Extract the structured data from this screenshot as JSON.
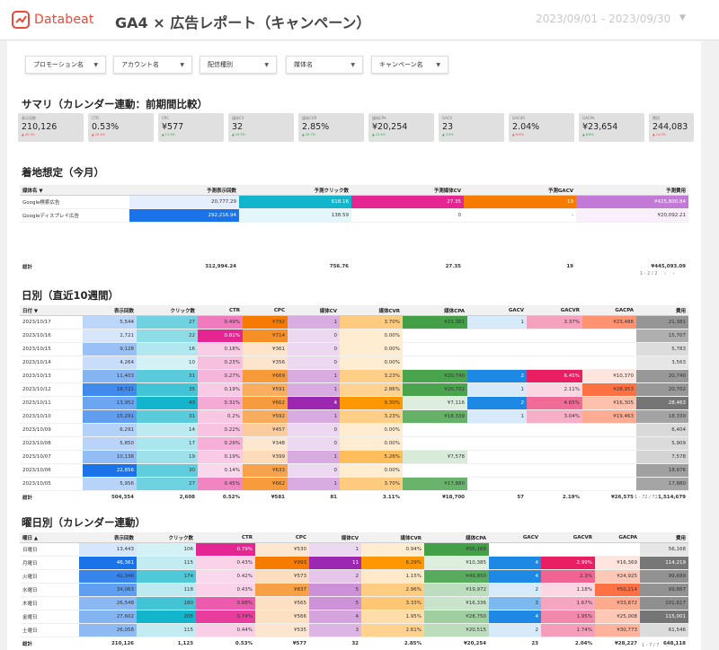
{
  "header": {
    "brand": "Databeat",
    "title": "GA4 × 広告レポート（キャンペーン）",
    "date_range": "2023/09/01 - 2023/09/30"
  },
  "filters": [
    "プロモーション名",
    "アカウント名",
    "配信種別",
    "媒体名",
    "キャンペーン名"
  ],
  "sections": {
    "summary": "サマリ（カレンダー連動：前期間比較）",
    "landing": "着地想定（今月）",
    "daily": "日別（直近10週間）",
    "weekday": "曜日別（カレンダー連動）"
  },
  "kpis": [
    {
      "label": "表示回数",
      "value": "210,126",
      "change": "▲ 42.3%",
      "up": false
    },
    {
      "label": "CTR",
      "value": "0.53%",
      "change": "▲ 20.4%",
      "up": false
    },
    {
      "label": "CPC",
      "value": "¥577",
      "change": "▲ 11.9%",
      "up": true
    },
    {
      "label": "媒体CV",
      "value": "32",
      "change": "▲ 10.3%",
      "up": true
    },
    {
      "label": "媒体CVR",
      "value": "2.85%",
      "change": "▲ 20.7%",
      "up": true
    },
    {
      "label": "媒体CPA",
      "value": "¥20,254",
      "change": "▲ 12.4%",
      "up": true
    },
    {
      "label": "GACV",
      "value": "23",
      "change": "▲ 4.5%",
      "up": true
    },
    {
      "label": "GACVR",
      "value": "2.04%",
      "change": "▲ 6.9%",
      "up": false
    },
    {
      "label": "GACPA",
      "value": "¥23,654",
      "change": "▲ 8.8%",
      "up": true
    },
    {
      "label": "費用",
      "value": "244,083",
      "change": "▲ 14.0%",
      "up": false
    }
  ],
  "landing": {
    "headers": [
      "媒体名 ▼",
      "予測表示回数",
      "予測クリック数",
      "予測媒体CV",
      "予測GACV",
      "予測費用"
    ],
    "rows": [
      [
        "Google検索広告",
        "20,777.29",
        "618.16",
        "27.35",
        "19",
        "¥425,800.84"
      ],
      [
        "Googleディスプレイ広告",
        "292,216.94",
        "138.59",
        "0",
        "-",
        "¥20,092.21"
      ]
    ],
    "total": [
      "総計",
      "312,994.24",
      "756.76",
      "27.35",
      "19",
      "¥445,093.09"
    ],
    "pager": "1 - 2 / 2"
  },
  "daily": {
    "headers": [
      "日付 ▼",
      "表示回数",
      "クリック数",
      "CTR",
      "CPC",
      "媒体CV",
      "媒体CVR",
      "媒体CPA",
      "GACV",
      "GACVR",
      "GACPA",
      "費用"
    ],
    "rows": [
      [
        "2023/10/17",
        "5,544",
        "27",
        "0.49%",
        "¥792",
        "1",
        "3.70%",
        "¥21,381",
        "1",
        "3.37%",
        "¥23,486",
        "21,381"
      ],
      [
        "2023/10/16",
        "2,721",
        "22",
        "0.81%",
        "¥714",
        "0",
        "0.00%",
        "",
        "",
        "",
        "",
        "15,707"
      ],
      [
        "2023/10/15",
        "9,128",
        "16",
        "0.18%",
        "¥361",
        "0",
        "0.00%",
        "",
        "",
        "",
        "",
        "5,783"
      ],
      [
        "2023/10/14",
        "4,264",
        "10",
        "0.23%",
        "¥356",
        "0",
        "0.00%",
        "",
        "",
        "",
        "",
        "3,563"
      ],
      [
        "2023/10/13",
        "11,403",
        "31",
        "0.27%",
        "¥669",
        "1",
        "3.23%",
        "¥20,740",
        "2",
        "6.45%",
        "¥10,370",
        "20,740"
      ],
      [
        "2023/10/12",
        "18,721",
        "35",
        "0.19%",
        "¥591",
        "1",
        "2.86%",
        "¥20,702",
        "1",
        "2.11%",
        "¥28,953",
        "20,702"
      ],
      [
        "2023/10/11",
        "13,952",
        "43",
        "0.31%",
        "¥662",
        "4",
        "9.30%",
        "¥7,116",
        "2",
        "4.65%",
        "¥16,305",
        "28,463"
      ],
      [
        "2023/10/10",
        "15,291",
        "31",
        "0.2%",
        "¥592",
        "1",
        "3.23%",
        "¥18,339",
        "1",
        "3.04%",
        "¥19,463",
        "18,339"
      ],
      [
        "2023/10/09",
        "6,291",
        "14",
        "0.22%",
        "¥457",
        "0",
        "0.00%",
        "",
        "",
        "",
        "",
        "6,404"
      ],
      [
        "2023/10/08",
        "5,850",
        "17",
        "0.29%",
        "¥348",
        "0",
        "0.00%",
        "",
        "",
        "",
        "",
        "5,909"
      ],
      [
        "2023/10/07",
        "10,136",
        "19",
        "0.19%",
        "¥399",
        "1",
        "5.26%",
        "¥7,578",
        "",
        "",
        "",
        "7,578"
      ],
      [
        "2023/10/06",
        "22,856",
        "30",
        "0.14%",
        "¥633",
        "0",
        "0.00%",
        "",
        "",
        "",
        "",
        "18,976"
      ],
      [
        "2023/10/05",
        "5,956",
        "27",
        "0.45%",
        "¥662",
        "1",
        "3.70%",
        "¥17,880",
        "",
        "",
        "",
        "17,880"
      ]
    ],
    "total": [
      "総計",
      "504,354",
      "2,608",
      "0.52%",
      "¥581",
      "81",
      "3.11%",
      "¥18,700",
      "57",
      "2.19%",
      "¥26,575",
      "1,514,679"
    ],
    "pager": "1 - 72 / 72"
  },
  "weekday": {
    "headers": [
      "曜日 ▲",
      "表示回数",
      "クリック数",
      "CTR",
      "CPC",
      "媒体CV",
      "媒体CVR",
      "媒体CPA",
      "GACV",
      "GACVR",
      "GACPA",
      "費用"
    ],
    "rows": [
      [
        "日曜日",
        "13,443",
        "106",
        "0.79%",
        "¥530",
        "1",
        "0.94%",
        "¥56,168",
        "",
        "",
        "",
        "56,168"
      ],
      [
        "月曜日",
        "46,361",
        "115",
        "0.43%",
        "¥993",
        "11",
        "6.29%",
        "¥10,385",
        "4",
        "2.99%",
        "¥16,369",
        "114,219"
      ],
      [
        "火曜日",
        "41,346",
        "174",
        "0.42%",
        "¥573",
        "2",
        "1.15%",
        "¥49,850",
        "4",
        "2.3%",
        "¥24,925",
        "99,699"
      ],
      [
        "水曜日",
        "34,063",
        "118",
        "0.43%",
        "¥837",
        "5",
        "2.96%",
        "¥19,972",
        "2",
        "1.18%",
        "¥50,214",
        "99,867"
      ],
      [
        "木曜日",
        "26,548",
        "180",
        "0.68%",
        "¥565",
        "5",
        "3.33%",
        "¥16,336",
        "3",
        "1.67%",
        "¥33,872",
        "101,617"
      ],
      [
        "金曜日",
        "27,602",
        "205",
        "0.74%",
        "¥566",
        "4",
        "1.95%",
        "¥28,750",
        "4",
        "1.95%",
        "¥25,008",
        "115,001"
      ],
      [
        "土曜日",
        "26,058",
        "115",
        "0.44%",
        "¥535",
        "3",
        "2.61%",
        "¥20,515",
        "2",
        "1.74%",
        "¥30,773",
        "61,546"
      ]
    ],
    "total": [
      "総計",
      "210,126",
      "1,123",
      "0.53%",
      "¥577",
      "32",
      "2.85%",
      "¥20,254",
      "23",
      "2.04%",
      "¥28,227",
      "648,118"
    ],
    "pager": "1 - 7 / 7"
  }
}
